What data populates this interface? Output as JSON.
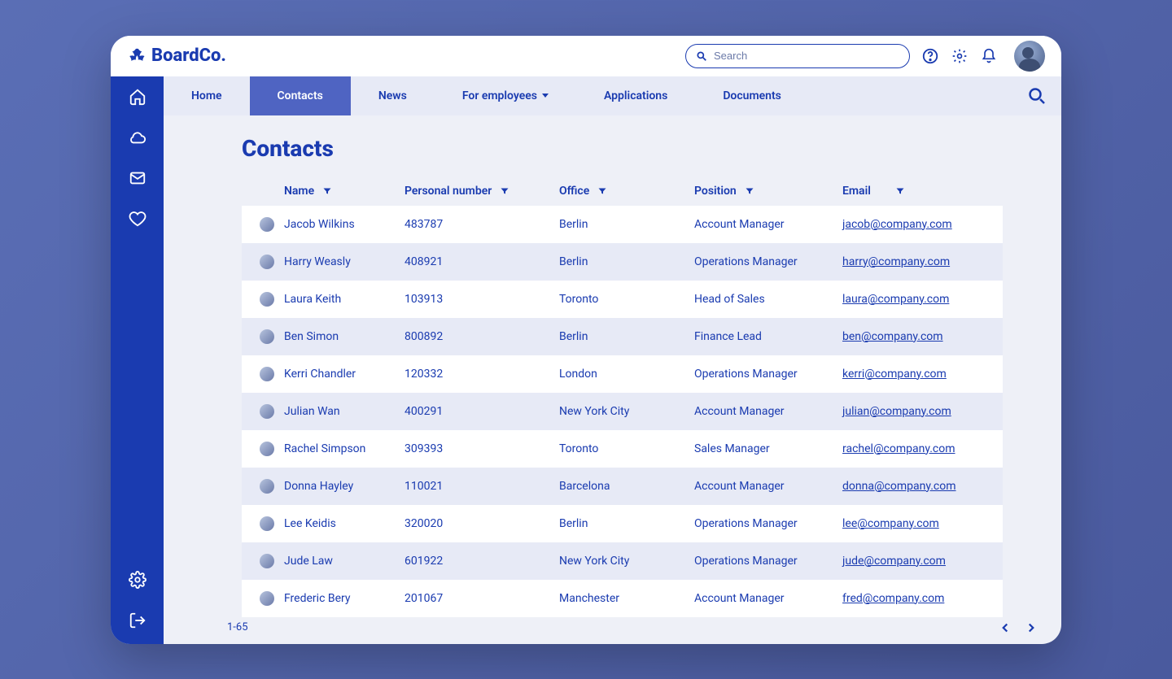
{
  "brand": {
    "name": "BoardCo."
  },
  "search": {
    "placeholder": "Search"
  },
  "tabs": [
    {
      "label": "Home"
    },
    {
      "label": "Contacts"
    },
    {
      "label": "News"
    },
    {
      "label": "For employees"
    },
    {
      "label": "Applications"
    },
    {
      "label": "Documents"
    }
  ],
  "page": {
    "title": "Contacts"
  },
  "columns": {
    "name": "Name",
    "personal": "Personal number",
    "office": "Office",
    "position": "Position",
    "email": "Email"
  },
  "rows": [
    {
      "name": "Jacob Wilkins",
      "personal": "483787",
      "office": "Berlin",
      "position": "Account Manager",
      "email": "jacob@company.com"
    },
    {
      "name": "Harry Weasly",
      "personal": "408921",
      "office": "Berlin",
      "position": "Operations Manager",
      "email": "harry@company.com"
    },
    {
      "name": "Laura Keith",
      "personal": "103913",
      "office": "Toronto",
      "position": "Head of Sales",
      "email": "laura@company.com"
    },
    {
      "name": "Ben Simon",
      "personal": "800892",
      "office": "Berlin",
      "position": "Finance Lead",
      "email": "ben@company.com"
    },
    {
      "name": "Kerri Chandler",
      "personal": "120332",
      "office": "London",
      "position": "Operations Manager",
      "email": "kerri@company.com"
    },
    {
      "name": "Julian Wan",
      "personal": "400291",
      "office": "New York City",
      "position": "Account Manager",
      "email": "julian@company.com"
    },
    {
      "name": "Rachel Simpson",
      "personal": "309393",
      "office": "Toronto",
      "position": "Sales Manager",
      "email": "rachel@company.com"
    },
    {
      "name": "Donna Hayley",
      "personal": "110021",
      "office": "Barcelona",
      "position": "Account Manager",
      "email": "donna@company.com"
    },
    {
      "name": "Lee Keidis",
      "personal": "320020",
      "office": "Berlin",
      "position": "Operations Manager",
      "email": "lee@company.com"
    },
    {
      "name": "Jude Law",
      "personal": "601922",
      "office": "New York City",
      "position": "Operations Manager",
      "email": "jude@company.com"
    },
    {
      "name": "Frederic Bery",
      "personal": "201067",
      "office": "Manchester",
      "position": "Account Manager",
      "email": "fred@company.com"
    }
  ],
  "footer": {
    "range": "1-65"
  }
}
